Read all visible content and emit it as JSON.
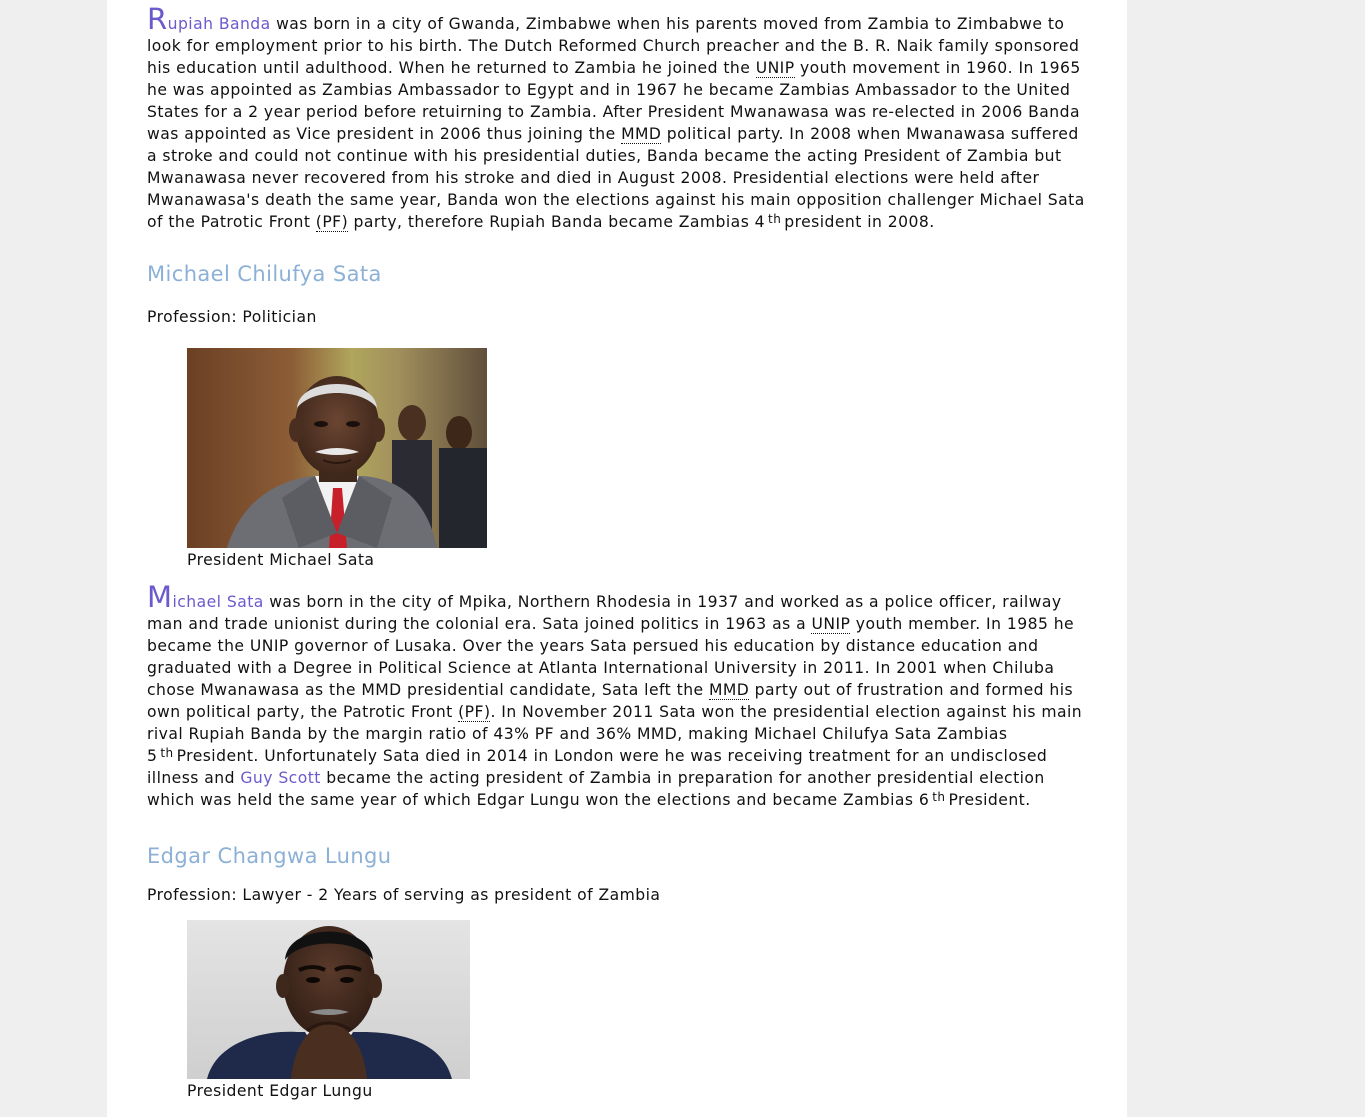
{
  "banda_paragraph": {
    "dropcap": "R",
    "link_rest": "upiah Banda",
    "t1": " was born in a city of Gwanda, Zimbabwe when his parents moved from Zambia to Zimbabwe to look for employment prior to his birth. The Dutch Reformed Church preacher and the B. R. Naik family sponsored his education until adulthood. When he returned to Zambia he joined the ",
    "abbr_unip": "UNIP",
    "t2": " youth movement in 1960. In 1965 he was appointed as Zambias Ambassador to Egypt and in 1967 he became Zambias Ambassador to the United States for a 2 year period before retuirning to Zambia. After President Mwanawasa was re-elected in 2006 Banda was appointed as Vice president in 2006 thus joining the ",
    "abbr_mmd": "MMD",
    "t3": " political party. In 2008 when Mwanawasa suffered a stroke and could not continue with his presidential duties, Banda became the acting President of Zambia but Mwanawasa never recovered from his stroke and died in August 2008. Presidential elections were held after Mwanawasa's death the same year, Banda won the elections against his main opposition challenger Michael Sata of the Patrotic Front ",
    "abbr_pf": "(PF)",
    "t4": " party, therefore Rupiah Banda became Zambias 4",
    "sup": "th",
    "t5": "president in 2008."
  },
  "sata_section": {
    "heading": "Michael Chilufya Sata",
    "profession": "Profession: Politician",
    "caption": "President Michael Sata"
  },
  "sata_paragraph": {
    "dropcap": "M",
    "link_rest": "ichael Sata",
    "t1": " was born in the city of Mpika, Northern Rhodesia in 1937 and worked as a police officer, railway man and trade unionist during the colonial era. Sata joined politics in 1963 as a ",
    "abbr_unip": "UNIP",
    "t2": " youth member. In 1985 he became the UNIP governor of Lusaka. Over the years Sata persued his education by distance education and graduated with a Degree in Political Science at Atlanta International University in 2011. In 2001 when Chiluba chose Mwanawasa as the MMD presidential candidate, Sata left the ",
    "abbr_mmd": "MMD",
    "t3": " party out of frustration and formed his own political party, the Patrotic Front ",
    "abbr_pf": "(PF)",
    "t4": ". In November 2011 Sata won the presidential election against his main rival Rupiah Banda by the margin ratio of 43% PF and 36% MMD, making Michael Chilufya Sata Zambias 5",
    "sup1": "th",
    "t5": "President. Unfortunately Sata died in 2014 in London were he was receiving treatment for an undisclosed illness and ",
    "link_scott": "Guy Scott",
    "t6": " became the acting president of Zambia in preparation for another presidential election which was held the same year of which Edgar Lungu won the elections and became Zambias 6",
    "sup2": "th",
    "t7": "President."
  },
  "lungu_section": {
    "heading": "Edgar Changwa Lungu",
    "profession": "Profession: Lawyer - 2 Years of serving as president of Zambia",
    "caption": "President Edgar Lungu"
  },
  "colors": {
    "link": "#6a5acd",
    "heading": "#8cb0d6",
    "page_bg": "#efefef",
    "content_bg": "#ffffff"
  }
}
